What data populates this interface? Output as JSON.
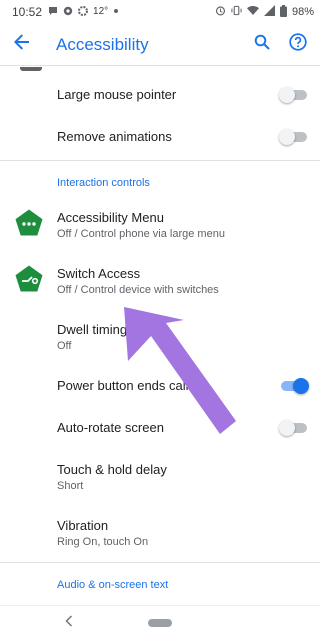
{
  "status_bar": {
    "time": "10:52",
    "temperature": "12°",
    "battery_percent": "98%"
  },
  "app_bar": {
    "title": "Accessibility"
  },
  "items": {
    "large_pointer": {
      "label": "Large mouse pointer",
      "enabled": false
    },
    "remove_animations": {
      "label": "Remove animations",
      "enabled": false
    },
    "accessibility_menu": {
      "label": "Accessibility Menu",
      "summary": "Off / Control phone via large menu"
    },
    "switch_access": {
      "label": "Switch Access",
      "summary": "Off / Control device with switches"
    },
    "dwell_timing": {
      "label": "Dwell timing",
      "summary": "Off"
    },
    "power_button": {
      "label": "Power button ends call",
      "enabled": true
    },
    "auto_rotate": {
      "label": "Auto-rotate screen",
      "enabled": false
    },
    "touch_hold": {
      "label": "Touch & hold delay",
      "summary": "Short"
    },
    "vibration": {
      "label": "Vibration",
      "summary": "Ring On, touch On"
    }
  },
  "sections": {
    "interaction_controls": "Interaction controls",
    "audio": "Audio & on-screen text"
  },
  "colors": {
    "accent": "#1a73e8",
    "icon_green": "#1e8e3e",
    "annotation_purple": "#a375e0"
  },
  "icons": {
    "back": "arrow-left-icon",
    "search": "search-icon",
    "help": "help-circle-icon",
    "accessibility_menu": "accessibility-menu-icon",
    "switch_access": "switch-access-icon"
  }
}
